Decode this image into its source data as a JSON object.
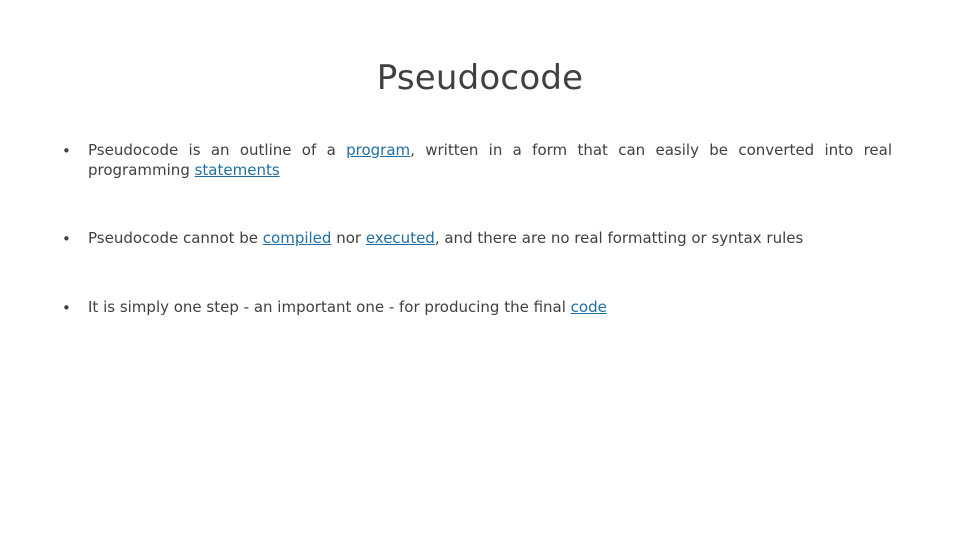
{
  "slide": {
    "title": "Pseudocode",
    "bullet_marker": "•",
    "accent_link_color": "#1f6fa5",
    "text_color": "#404040",
    "bullets": [
      {
        "id": "bullet-1",
        "justified": true,
        "segments": [
          {
            "text": "Pseudocode is an outline of a ",
            "link": false
          },
          {
            "text": "program",
            "link": true
          },
          {
            "text": ", written in a form that can easily be converted into real programming ",
            "link": false
          },
          {
            "text": "statements",
            "link": true
          }
        ]
      },
      {
        "id": "bullet-2",
        "justified": true,
        "segments": [
          {
            "text": "Pseudocode cannot be ",
            "link": false
          },
          {
            "text": "compiled",
            "link": true
          },
          {
            "text": " nor ",
            "link": false
          },
          {
            "text": "executed",
            "link": true
          },
          {
            "text": ", and there are no real formatting or syntax rules",
            "link": false
          }
        ]
      },
      {
        "id": "bullet-3",
        "justified": false,
        "segments": [
          {
            "text": "It is simply one step - an important one - for producing the final ",
            "link": false
          },
          {
            "text": "code",
            "link": true
          }
        ]
      }
    ]
  }
}
